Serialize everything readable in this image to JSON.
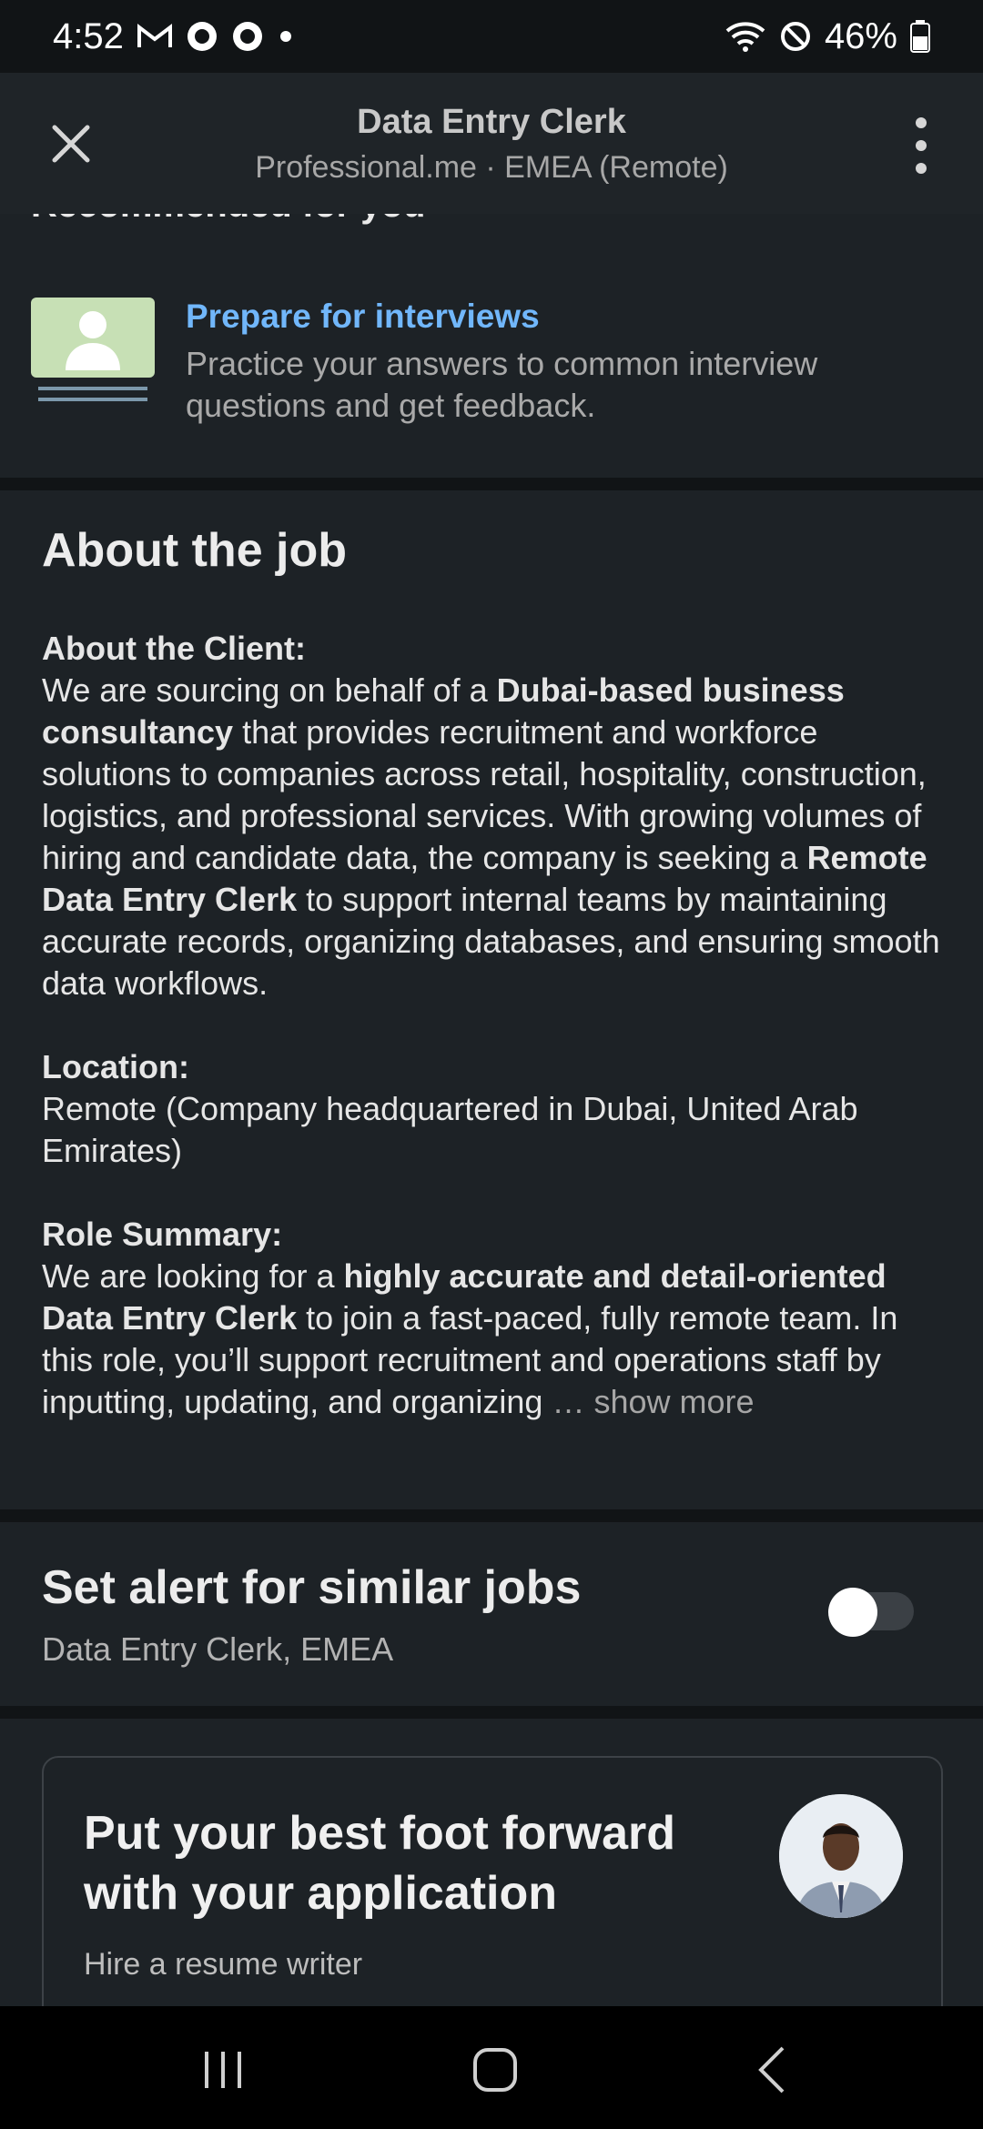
{
  "status_bar": {
    "time": "4:52",
    "battery": "46%",
    "icons": [
      "gmail-icon",
      "chat-icon",
      "chat-icon",
      "dot-icon",
      "wifi-icon",
      "do-not-disturb-icon",
      "battery-icon"
    ]
  },
  "header": {
    "title": "Data Entry Clerk",
    "subtitle": "Professional.me · EMEA (Remote)"
  },
  "recommended": {
    "title": "Recommended for you",
    "card": {
      "link": "Prepare for interviews",
      "description": "Practice your answers to common interview questions and get feedback."
    }
  },
  "about": {
    "title": "About the job",
    "client_label": "About the Client:",
    "client_text_1": "We are sourcing on behalf of a ",
    "client_bold_1": "Dubai-based business consultancy",
    "client_text_2": " that provides recruitment and workforce solutions to companies across retail, hospitality, construction, logistics, and professional services. With growing volumes of hiring and candidate data, the company is seeking a ",
    "client_bold_2": "Remote Data Entry Clerk",
    "client_text_3": " to support internal teams by maintaining accurate records, organizing databases, and ensuring smooth data workflows.",
    "location_label": "Location:",
    "location_text": "Remote (Company headquartered in Dubai, United Arab Emirates)",
    "role_label": "Role Summary:",
    "role_text_1": "We are looking for a ",
    "role_bold_1": "highly accurate and detail-oriented Data Entry Clerk",
    "role_text_2": " to join a fast-paced, fully remote team. In this role, you’ll support recruitment and operations staff by inputting, updating, and organizing ",
    "show_more": "… show more"
  },
  "alert": {
    "title": "Set alert for similar jobs",
    "subtitle": "Data Entry Clerk, EMEA",
    "enabled": false
  },
  "promo": {
    "title": "Put your best foot forward with your application",
    "subtitle": "Hire a resume writer"
  },
  "colors": {
    "background": "#1d2226",
    "link": "#71b7fb",
    "divider": "#111416"
  }
}
